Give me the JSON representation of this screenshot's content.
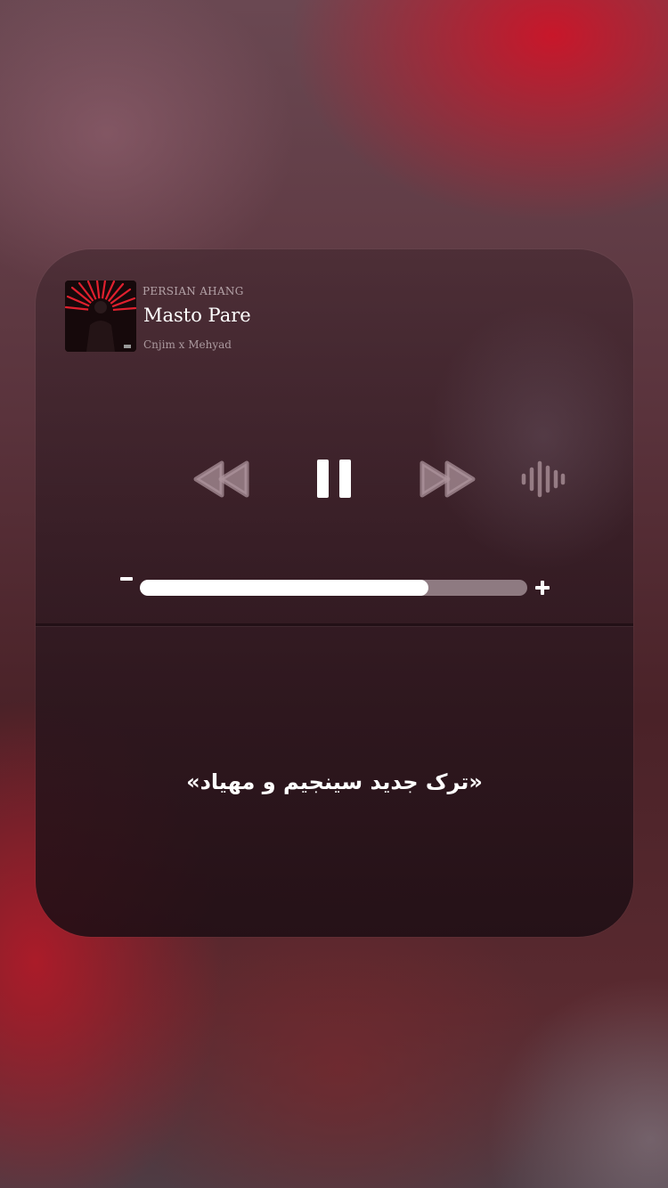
{
  "now_playing": {
    "source": "PERSIAN AHANG",
    "title": "Masto Pare",
    "artist": "Cnjim x Mehyad",
    "artwork_icon": "album-artwork"
  },
  "controls": {
    "rewind_icon": "rewind-icon",
    "pause_icon": "pause-icon",
    "forward_icon": "fast-forward-icon",
    "output_icon": "waveform-icon"
  },
  "volume": {
    "level": 0.745,
    "minus_icon": "volume-minus-icon",
    "plus_icon": "volume-plus-icon"
  },
  "caption": "«ترک جدید سینجیم و مهیاد»",
  "colors": {
    "accent_red": "#d0101f",
    "text_primary": "#ffffff"
  }
}
